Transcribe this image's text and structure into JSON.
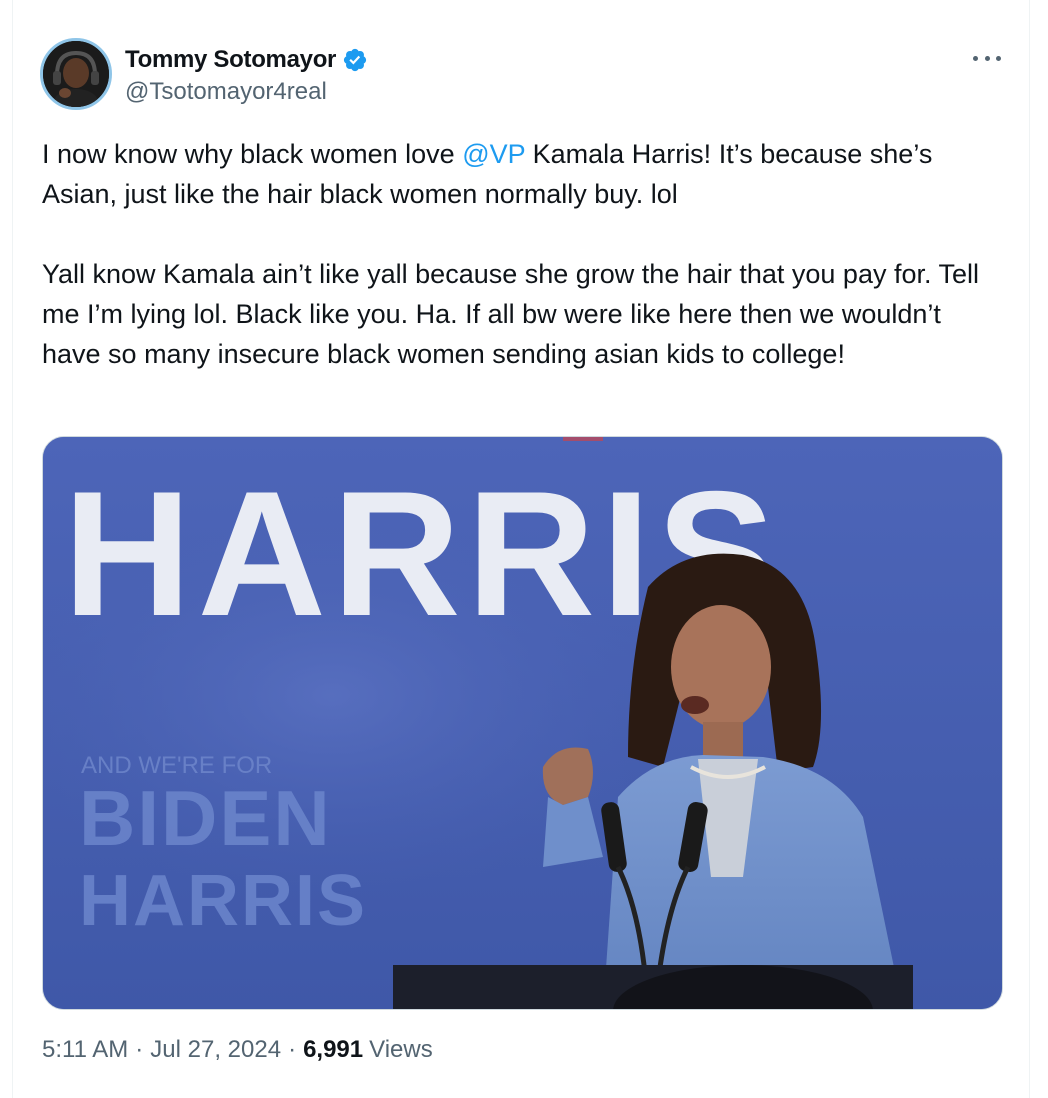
{
  "author": {
    "display_name": "Tommy Sotomayor",
    "handle": "@Tsotomayor4real",
    "verified": true,
    "verified_icon": "verified-badge-icon",
    "avatar_icon": "avatar"
  },
  "more_icon": "more-options-icon",
  "tweet": {
    "p1_before": "I now know why black women love ",
    "mention": "@VP",
    "p1_after": " Kamala Harris!   It’s because she’s Asian, just like the hair black women normally buy.  lol",
    "p2": "Yall know Kamala ain’t like yall because she grow the hair that you pay for.  Tell me I’m lying lol.  Black like you. Ha. If all bw were like here then we wouldn’t have so many insecure black women sending asian kids to college!"
  },
  "media": {
    "sign_main": "HARRIS",
    "sign_small_top": "BIDEN",
    "sign_small_bottom": "HARRIS",
    "sign_small_overline": "AND WE'RE FOR"
  },
  "meta": {
    "time": "5:11 AM",
    "separator": "·",
    "date": "Jul 27, 2024",
    "views_count": "6,991",
    "views_label": "Views"
  },
  "colors": {
    "link": "#1d9bf0",
    "secondary_text": "#536471",
    "primary_text": "#0f1419",
    "verified": "#1d9bf0",
    "media_bg": "#4a62b4"
  }
}
